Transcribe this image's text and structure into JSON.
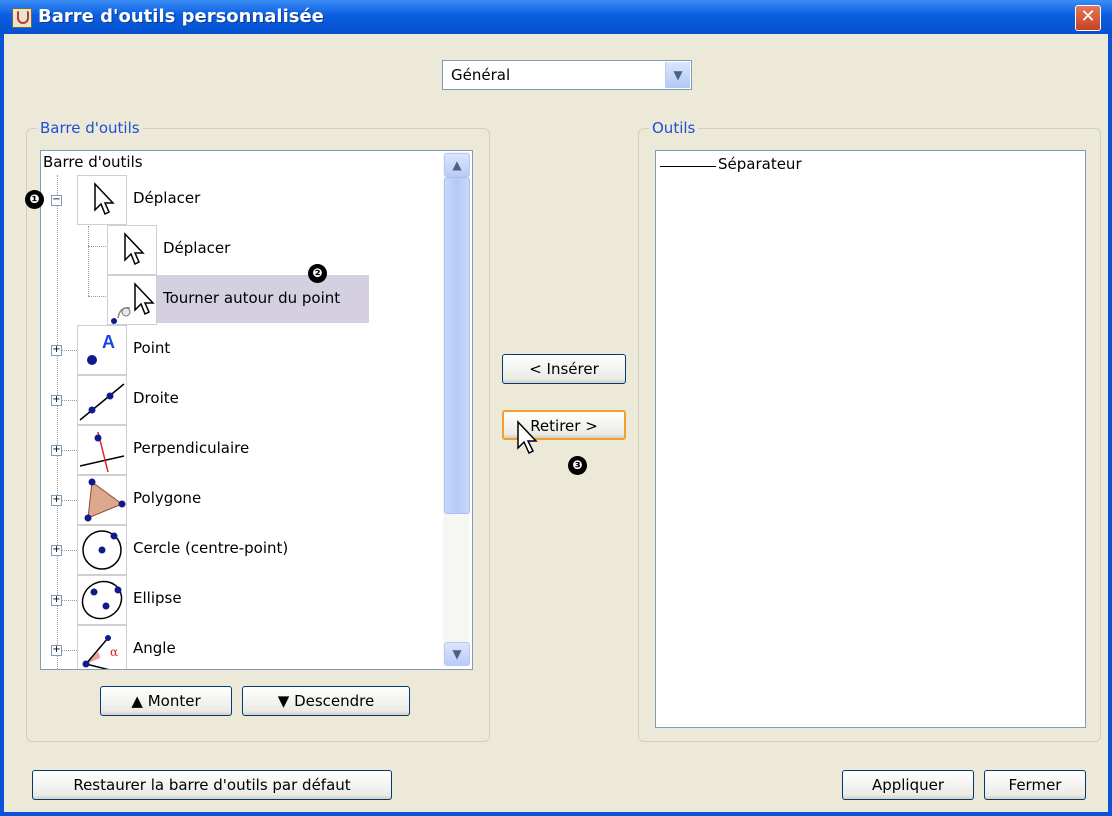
{
  "window": {
    "title": "Barre d'outils personnalisée",
    "close_symbol": "✕"
  },
  "category": {
    "selected": "Général",
    "arrow": "▼"
  },
  "left_group": {
    "title": "Barre d'outils",
    "tree_root": "Barre d'outils",
    "items": [
      {
        "label": "Déplacer",
        "icon": "move-arrow-icon",
        "expanded": true
      },
      {
        "label": "Déplacer",
        "icon": "move-arrow-icon",
        "child": true
      },
      {
        "label": "Tourner autour du point",
        "icon": "rotate-around-point-icon",
        "child": true,
        "selected": true
      },
      {
        "label": "Point",
        "icon": "point-icon"
      },
      {
        "label": "Droite",
        "icon": "line-icon"
      },
      {
        "label": "Perpendiculaire",
        "icon": "perpendicular-icon"
      },
      {
        "label": "Polygone",
        "icon": "polygon-icon"
      },
      {
        "label": "Cercle (centre-point)",
        "icon": "circle-icon"
      },
      {
        "label": "Ellipse",
        "icon": "ellipse-icon"
      },
      {
        "label": "Angle",
        "icon": "angle-icon"
      }
    ],
    "buttons": {
      "up": "Monter",
      "down": "Descendre",
      "up_glyph": "▲",
      "down_glyph": "▼"
    }
  },
  "middle": {
    "insert": "< Insérer",
    "remove": "Retirer >"
  },
  "right_group": {
    "title": "Outils",
    "items": [
      "Séparateur"
    ]
  },
  "footer": {
    "restore": "Restaurer la barre d'outils par défaut",
    "apply": "Appliquer",
    "close": "Fermer"
  },
  "markers": [
    "❶",
    "❷",
    "❸"
  ],
  "colors": {
    "titlebar": "#0a5fe0",
    "group_title": "#1f4fd6",
    "selection": "#d4d0e0",
    "point_dot": "#101a8c",
    "point_label": "#1a44e6",
    "polygon_fill": "#dca98f",
    "perp_line": "#e02020"
  }
}
